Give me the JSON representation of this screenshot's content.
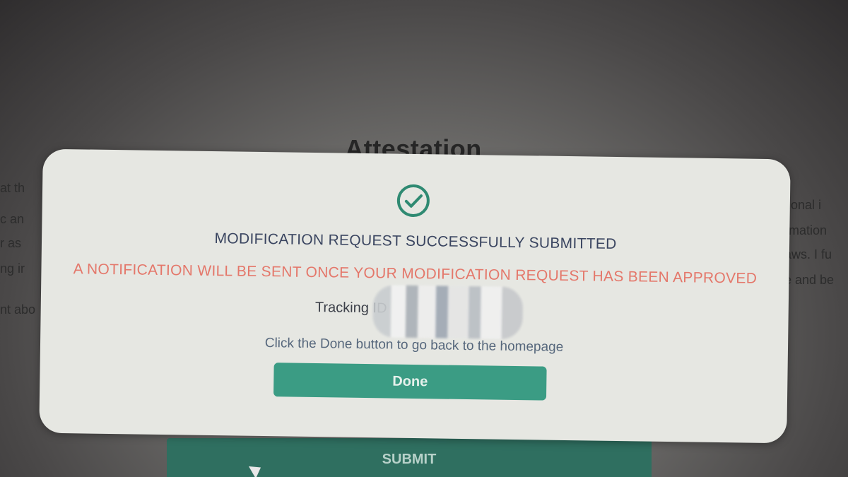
{
  "background": {
    "page_title": "Attestation",
    "left_fragments": [
      "at th",
      "c an",
      "r as",
      "ng ir",
      "nt abo"
    ],
    "right_fragments": [
      "tional i",
      "rmation",
      "aws. I fu",
      "e and be"
    ],
    "submit_label": "SUBMIT"
  },
  "modal": {
    "icon": "check-circle-icon",
    "title": "MODIFICATION REQUEST SUCCESSFULLY SUBMITTED",
    "notice": "A NOTIFICATION WILL BE SENT ONCE YOUR MODIFICATION REQUEST HAS BEEN APPROVED",
    "tracking_label": "Tracking ID",
    "hint": "Click the Done button to go back to the homepage",
    "done_label": "Done"
  },
  "colors": {
    "accent": "#3b9c84",
    "notice": "#e4776a",
    "title": "#3a4560"
  }
}
